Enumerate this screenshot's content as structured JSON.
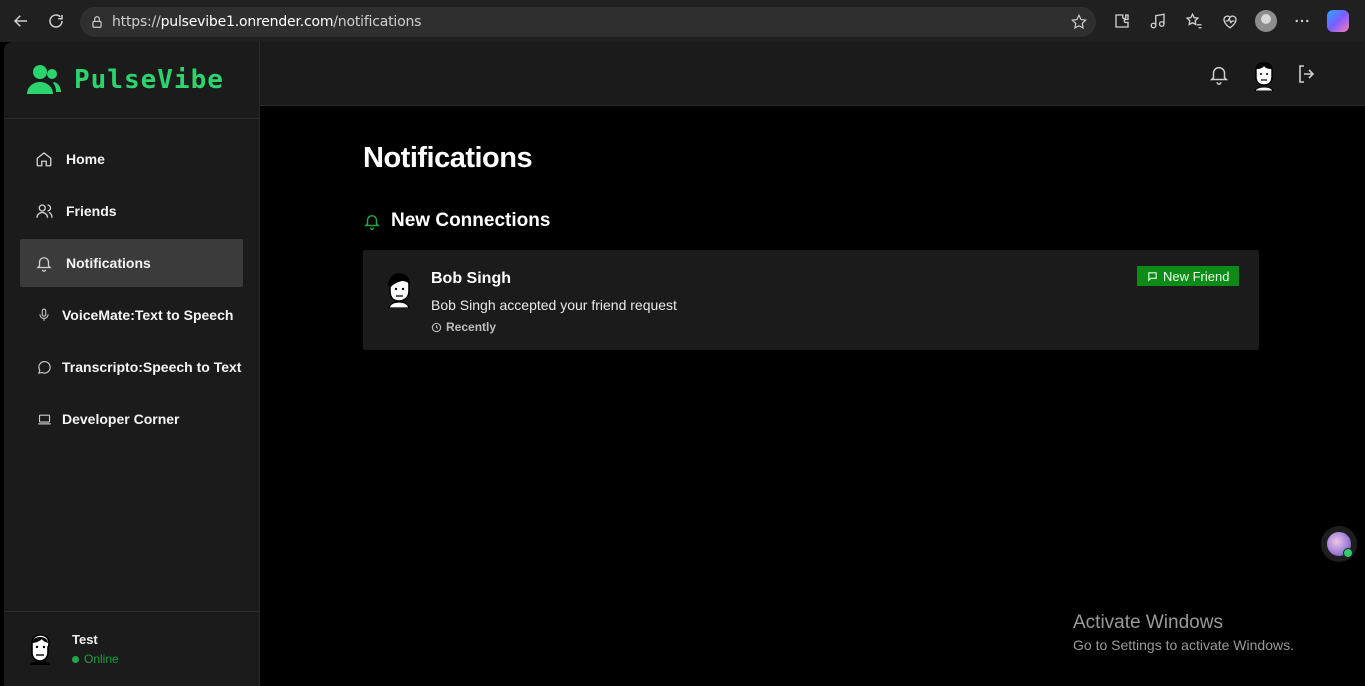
{
  "browser": {
    "url_prefix": "https://",
    "url_host": "pulsevibe1.onrender.com",
    "url_path": "/notifications"
  },
  "app": {
    "brand": "PulseVibe",
    "accent_color": "#2bd56e"
  },
  "sidebar": {
    "items": [
      {
        "label": "Home",
        "icon": "home-icon"
      },
      {
        "label": "Friends",
        "icon": "users-icon"
      },
      {
        "label": "Notifications",
        "icon": "bell-icon",
        "active": true
      },
      {
        "label": "VoiceMate:Text to Speech",
        "icon": "mic-icon"
      },
      {
        "label": "Transcripto:Speech to Text",
        "icon": "message-circle-icon"
      },
      {
        "label": "Developer Corner",
        "icon": "laptop-icon"
      }
    ]
  },
  "user": {
    "name": "Test",
    "status": "Online"
  },
  "main": {
    "title": "Notifications",
    "section_title": "New Connections",
    "notifications": [
      {
        "name": "Bob Singh",
        "message": "Bob Singh accepted your friend request",
        "time": "Recently",
        "badge": "New Friend"
      }
    ]
  },
  "watermark": {
    "line1": "Activate Windows",
    "line2": "Go to Settings to activate Windows."
  }
}
